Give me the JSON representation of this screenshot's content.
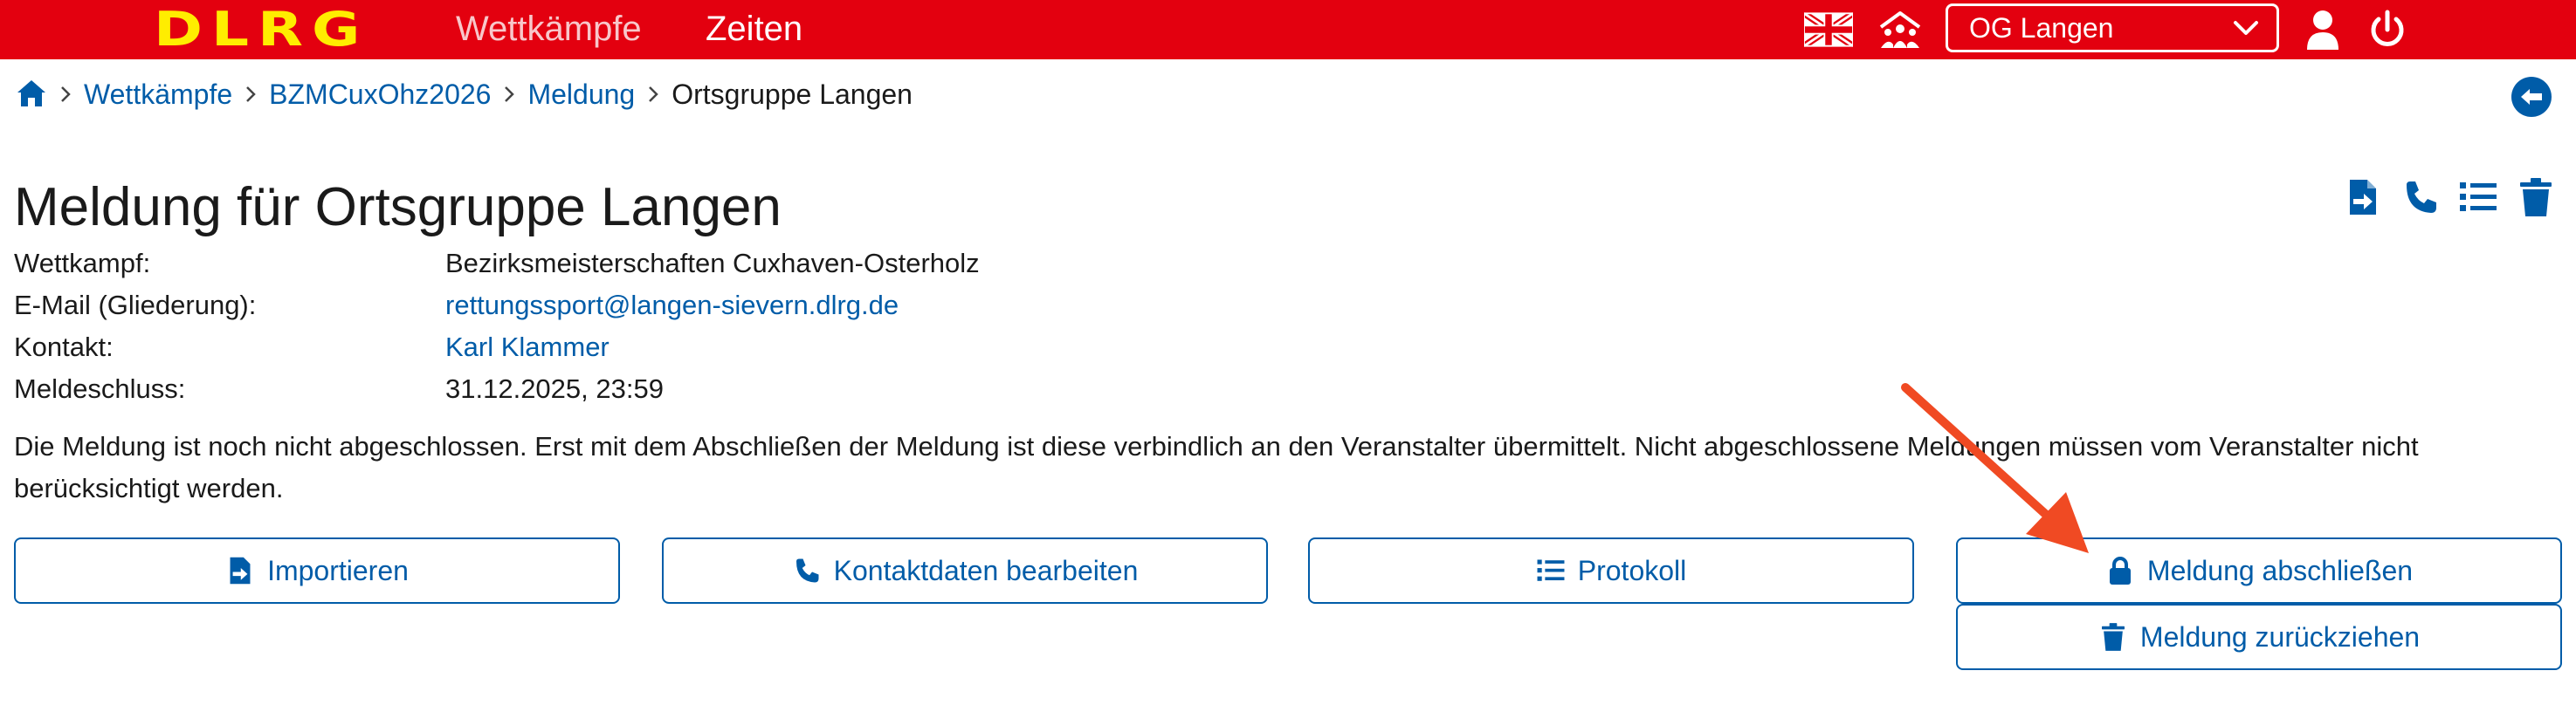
{
  "header": {
    "logo": "DLRG",
    "nav": [
      {
        "label": "Wettkämpfe"
      },
      {
        "label": "Zeiten"
      }
    ],
    "org_select": {
      "value": "OG Langen"
    },
    "icons": [
      "uk-flag-icon",
      "team-icon",
      "user-icon",
      "power-icon"
    ]
  },
  "breadcrumb": {
    "items": [
      {
        "label": "Wettkämpfe"
      },
      {
        "label": "BZMCuxOhz2026"
      },
      {
        "label": "Meldung"
      }
    ],
    "current": "Ortsgruppe Langen"
  },
  "page": {
    "title": "Meldung für Ortsgruppe Langen",
    "info": [
      {
        "label": "Wettkampf:",
        "value": "Bezirksmeisterschaften Cuxhaven-Osterholz"
      },
      {
        "label": "E-Mail (Gliederung):",
        "value": "rettungssport@langen-sievern.dlrg.de"
      },
      {
        "label": "Kontakt:",
        "value": "Karl Klammer"
      },
      {
        "label": "Meldeschluss:",
        "value": "31.12.2025, 23:59"
      }
    ],
    "notice": "Die Meldung ist noch nicht abgeschlossen. Erst mit dem Abschließen der Meldung ist diese verbindlich an den Veranstalter übermittelt. Nicht abgeschlossene Meldungen müssen vom Veranstalter nicht berücksichtigt werden."
  },
  "buttons": {
    "import": "Importieren",
    "contact": "Kontaktdaten bearbeiten",
    "protocol": "Protokoll",
    "close": "Meldung abschließen",
    "withdraw": "Meldung zurückziehen"
  },
  "colors": {
    "brand_red": "#e3000f",
    "brand_yellow": "#ffed00",
    "link_blue": "#005ca8",
    "annotation_arrow": "#f04a23"
  }
}
